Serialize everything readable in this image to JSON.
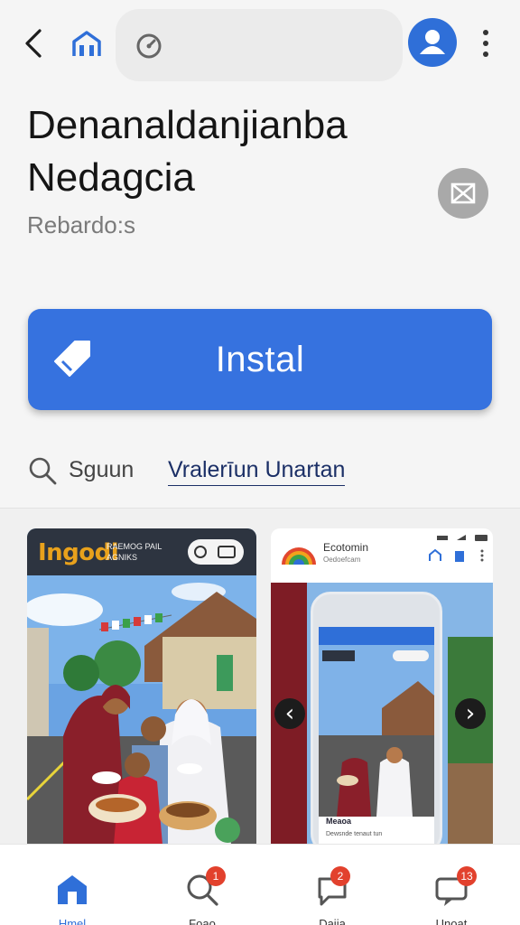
{
  "app": {
    "title": "Denanaldanjianba Nedagcia",
    "subtitle": "Rebardo:s",
    "install_label": "Instal"
  },
  "search": {
    "prefix": "Sguun",
    "link": "Vralerīun Unartan"
  },
  "screenshots": [
    {
      "brand": "Ingodi",
      "tagline": "RAEMOG PAIL AGNIKS"
    },
    {
      "app_name": "Ecotomin",
      "app_sub": "Oedoefcam",
      "card_title": "Meaoa",
      "card_text": "Dewsnde tenaut tun"
    }
  ],
  "bottom_nav": [
    {
      "label": "Hmel",
      "icon": "home-icon",
      "badge": "",
      "active": true
    },
    {
      "label": "Foao",
      "icon": "search-icon",
      "badge": "1",
      "active": false
    },
    {
      "label": "Daiia",
      "icon": "chat-icon",
      "badge": "2",
      "active": false
    },
    {
      "label": "Unoat",
      "icon": "updates-icon",
      "badge": "13",
      "active": false
    }
  ],
  "colors": {
    "accent": "#3672df",
    "badge": "#e2412d",
    "brand_orange": "#e8a11c"
  }
}
